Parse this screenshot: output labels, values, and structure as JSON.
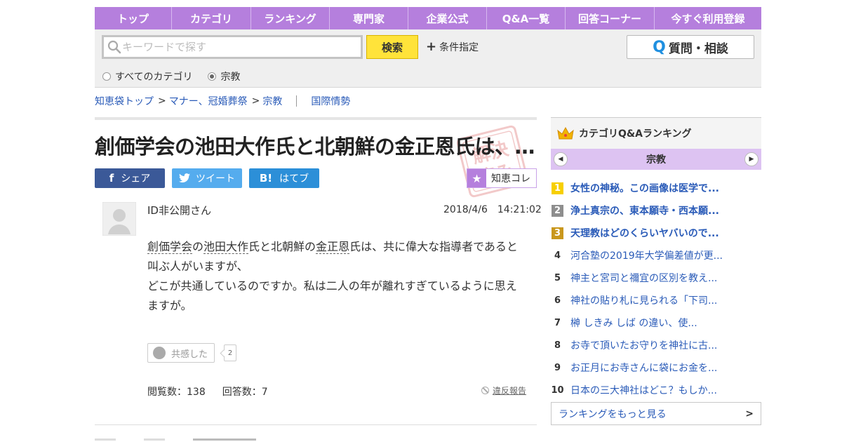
{
  "nav": {
    "items": [
      "トップ",
      "カテゴリ",
      "ランキング",
      "専門家",
      "企業公式",
      "Q&A一覧",
      "回答コーナー",
      "今すぐ利用登録"
    ]
  },
  "search": {
    "placeholder": "キーワードで探す",
    "button_label": "検索",
    "condition_label": "条件指定",
    "ask_button_label": "質問・相談",
    "radio_all": "すべてのカテゴリ",
    "radio_category": "宗教"
  },
  "breadcrumb": {
    "home": "知恵袋トップ",
    "level1": "マナー、冠婚葬祭",
    "level2": "宗教",
    "related": "国際情勢"
  },
  "question": {
    "title": "創価学会の池田大作氏と北朝鮮の金正恩氏は、…",
    "stamp_text": "解決済み",
    "share_facebook": "シェア",
    "share_twitter": "ツイート",
    "share_hatena": "はてブ",
    "chie_kore": "知恵コレ",
    "user_name": "ID非公開さん",
    "date": "2018/4/6　14:21:02",
    "body_kw1": "創価学会",
    "body_t1": "の",
    "body_kw2": "池田大作",
    "body_t2": "氏と北朝鮮の",
    "body_kw3": "金正恩",
    "body_t3": "氏は、共に偉大な指導者であると叫ぶ人がいますが、",
    "body_line3": "どこが共通しているのですか。私は二人の年が離れすぎているように思えますが。",
    "empathy_label": "共感した",
    "empathy_count": "2",
    "views": "閲覧数：138",
    "answers": "回答数：7",
    "report": "違反報告"
  },
  "ranking": {
    "heading": "カテゴリQ&Aランキング",
    "category": "宗教",
    "items": [
      {
        "rank": "1",
        "title": "女性の神秘。この画像は医学で..."
      },
      {
        "rank": "2",
        "title": "浄土真宗の、東本願寺・西本願..."
      },
      {
        "rank": "3",
        "title": "天理教はどのくらいヤバいので..."
      },
      {
        "rank": "4",
        "title": "河合塾の2019年大学偏差値が更..."
      },
      {
        "rank": "5",
        "title": "神主と宮司と禰宜の区別を教え..."
      },
      {
        "rank": "6",
        "title": "神社の貼り札に見られる「下司..."
      },
      {
        "rank": "7",
        "title": "榊 しきみ しば の違い、使..."
      },
      {
        "rank": "8",
        "title": "お寺で頂いたお守りを神社に古..."
      },
      {
        "rank": "9",
        "title": "お正月にお寺さんに袋にお金を..."
      },
      {
        "rank": "10",
        "title": "日本の三大神社はどこ？もしか..."
      }
    ],
    "more_label": "ランキングをもっと見る"
  },
  "colors": {
    "accent_purple": "#b57fdd",
    "search_yellow": "#ffe33a",
    "link_blue": "#2a5bb8",
    "facebook": "#3b5998",
    "twitter": "#55acee",
    "hatena": "#2c8fd8"
  }
}
